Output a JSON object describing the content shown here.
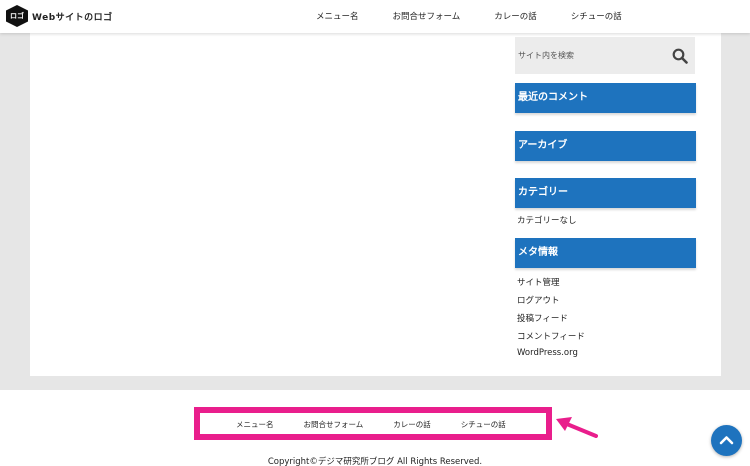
{
  "header": {
    "logo_mark": "ロゴ",
    "logo_text": "Webサイトのロゴ",
    "nav": [
      "メニュー名",
      "お問合せフォーム",
      "カレーの話",
      "シチューの話"
    ]
  },
  "sidebar": {
    "search": {
      "placeholder": "サイト内を検索"
    },
    "recent_comments": {
      "title": "最近のコメント"
    },
    "archives": {
      "title": "アーカイブ"
    },
    "categories": {
      "title": "カテゴリー",
      "items": [
        "カテゴリーなし"
      ]
    },
    "meta": {
      "title": "メタ情報",
      "items": [
        "サイト管理",
        "ログアウト",
        "投稿フィード",
        "コメントフィード",
        "WordPress.org"
      ]
    }
  },
  "footer": {
    "nav": [
      "メニュー名",
      "お問合せフォーム",
      "カレーの話",
      "シチューの話"
    ],
    "copyright": "Copyright©デジマ研究所ブログ All Rights Reserved."
  },
  "colors": {
    "accent": "#1e73be",
    "highlight": "#e91e8c",
    "page_bg": "#e6e6e6"
  },
  "icons": {
    "search": "search-icon",
    "to_top": "chevron-up-icon",
    "annotation": "arrow-icon"
  }
}
